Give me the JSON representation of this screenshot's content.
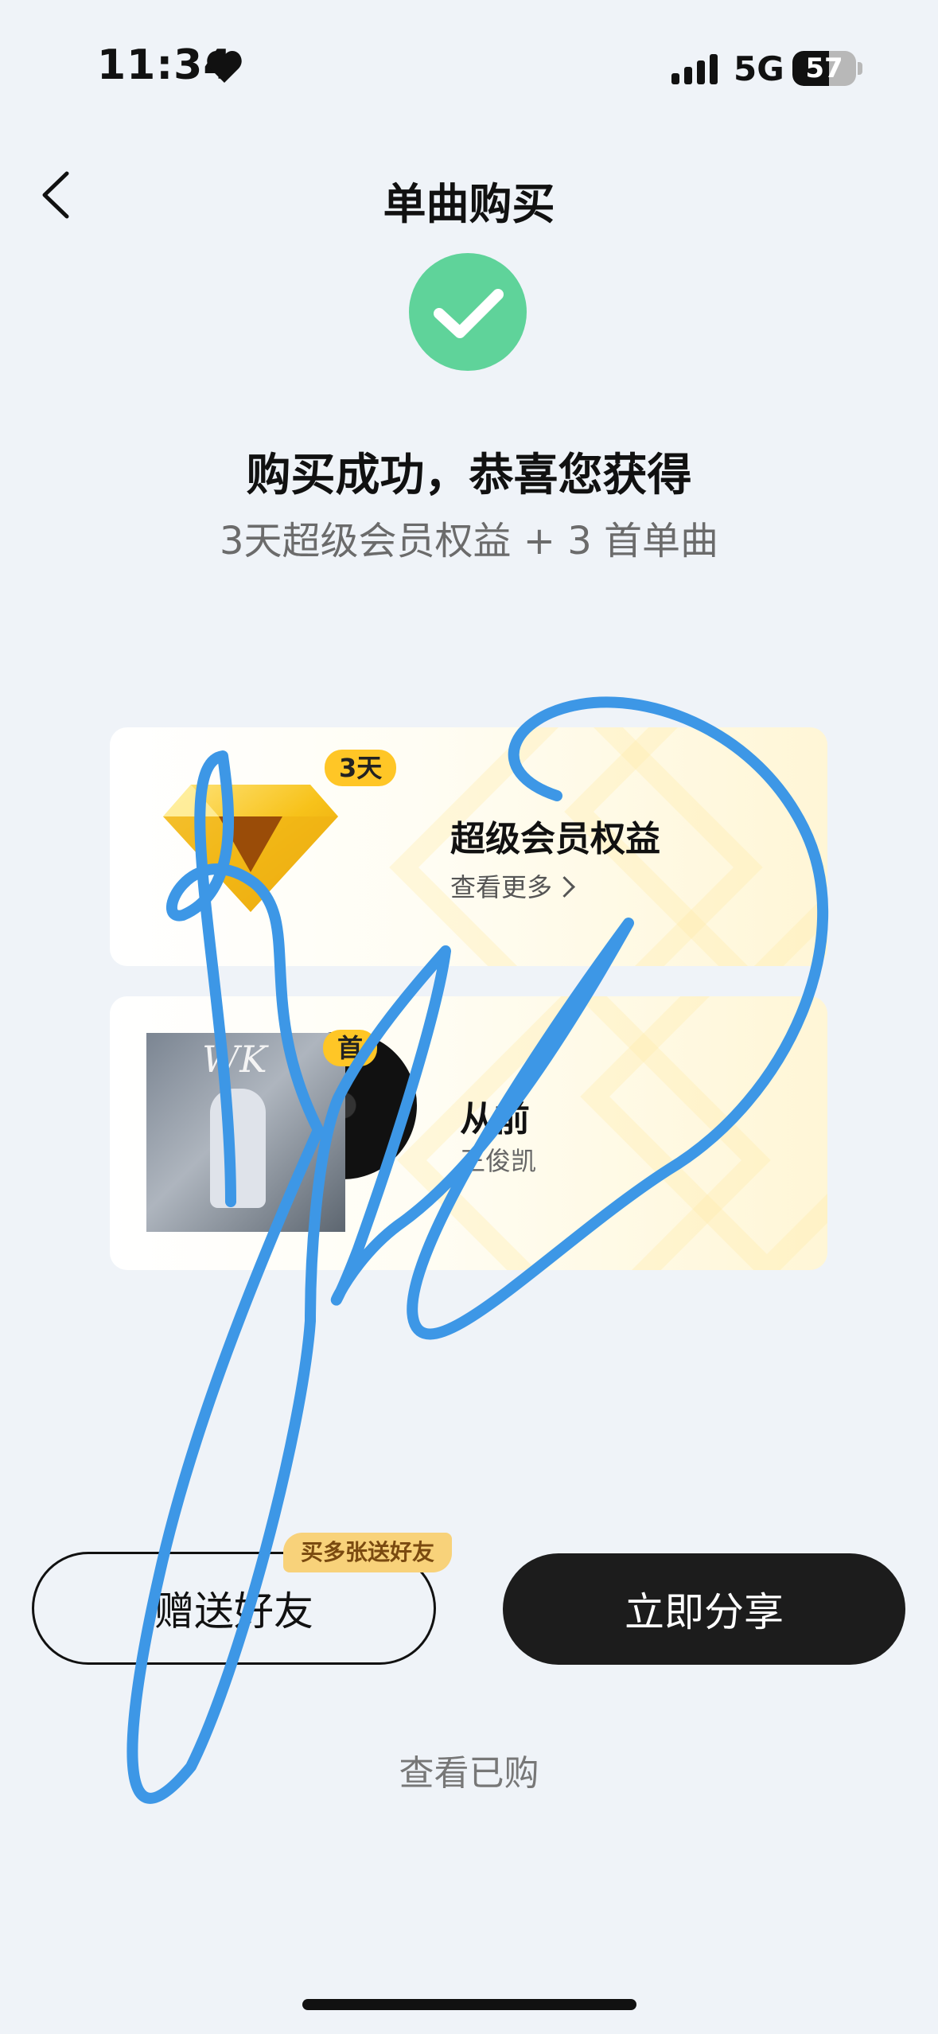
{
  "status_bar": {
    "time": "11:34",
    "network": "5G",
    "battery_level": 57,
    "battery_label": "57"
  },
  "header": {
    "title": "单曲购买"
  },
  "success": {
    "title": "购买成功，恭喜您获得",
    "subtitle": "3天超级会员权益 + 3 首单曲",
    "accent_color": "#5fd39a"
  },
  "cards": {
    "vip": {
      "badge": "3天",
      "title": "超级会员权益",
      "more_label": "查看更多"
    },
    "song": {
      "badge": "首",
      "title": "从前",
      "artist": "王俊凯",
      "cover_script": "WK"
    }
  },
  "actions": {
    "gift_label": "赠送好友",
    "gift_badge": "买多张送好友",
    "share_label": "立即分享",
    "view_purchased_label": "查看已购"
  },
  "overlay": {
    "stroke_color": "#3d97e6"
  }
}
